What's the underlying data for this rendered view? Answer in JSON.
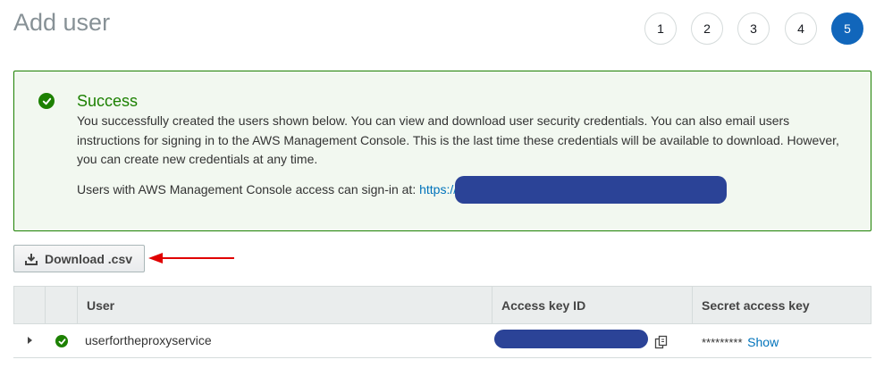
{
  "page": {
    "title": "Add user"
  },
  "steps": {
    "items": [
      "1",
      "2",
      "3",
      "4",
      "5"
    ],
    "current": "5",
    "active_color": "#1166bb"
  },
  "alert": {
    "icon": "check-circle-icon",
    "title": "Success",
    "body": "You successfully created the users shown below. You can view and download user security credentials. You can also email users instructions for signing in to the AWS Management Console. This is the last time these credentials will be available to download. However, you can create new credentials at any time.",
    "signin_prefix": "Users with AWS Management Console access can sign-in at: ",
    "signin_link": "https://",
    "success_color": "#1d8102"
  },
  "toolbar": {
    "download_label": "Download .csv",
    "download_icon": "download-icon"
  },
  "table": {
    "columns": [
      "User",
      "Access key ID",
      "Secret access key"
    ],
    "rows": [
      {
        "status": "success",
        "user": "userfortheproxyservice",
        "secret_masked": "*********",
        "show_label": "Show"
      }
    ]
  },
  "redaction_color": "#2b4397",
  "annotation_color": "#e00000"
}
